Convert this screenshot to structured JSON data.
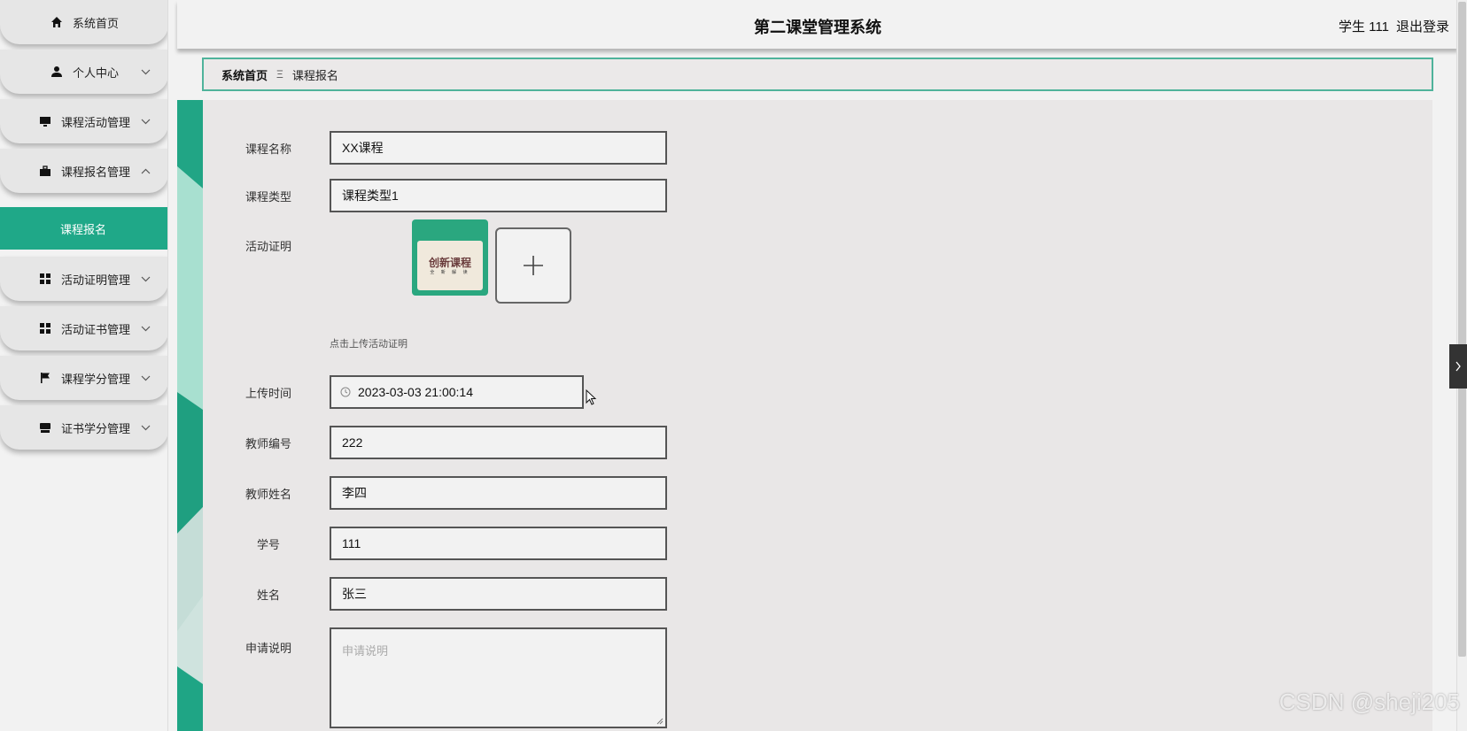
{
  "header": {
    "title": "第二课堂管理系统",
    "user": "学生 111",
    "logout": "退出登录"
  },
  "sidebar": {
    "items": [
      {
        "label": "系统首页",
        "icon": "home-icon"
      },
      {
        "label": "个人中心",
        "icon": "user-icon"
      },
      {
        "label": "课程活动管理",
        "icon": "monitor-icon"
      },
      {
        "label": "课程报名管理",
        "icon": "briefcase-icon"
      },
      {
        "label": "活动证明管理",
        "icon": "grid-icon"
      },
      {
        "label": "活动证书管理",
        "icon": "grid-icon"
      },
      {
        "label": "课程学分管理",
        "icon": "flag-icon"
      },
      {
        "label": "证书学分管理",
        "icon": "inbox-icon"
      }
    ],
    "active_sub": "课程报名"
  },
  "breadcrumb": {
    "home": "系统首页",
    "separator": "Ξ",
    "current": "课程报名"
  },
  "form": {
    "course_name": {
      "label": "课程名称",
      "value": "XX课程"
    },
    "course_type": {
      "label": "课程类型",
      "value": "课程类型1"
    },
    "proof": {
      "label": "活动证明",
      "thumb_text": "创新课程",
      "thumb_sub": "全 新 解 读",
      "hint": "点击上传活动证明"
    },
    "upload_time": {
      "label": "上传时间",
      "value": "2023-03-03 21:00:14"
    },
    "teacher_id": {
      "label": "教师编号",
      "value": "222"
    },
    "teacher_name": {
      "label": "教师姓名",
      "value": "李四"
    },
    "student_id": {
      "label": "学号",
      "value": "111"
    },
    "student_name": {
      "label": "姓名",
      "value": "张三"
    },
    "remark": {
      "label": "申请说明",
      "placeholder": "申请说明"
    }
  },
  "watermark": "CSDN @sheji205",
  "colors": {
    "accent": "#1fa888",
    "border": "#4fb39b"
  }
}
